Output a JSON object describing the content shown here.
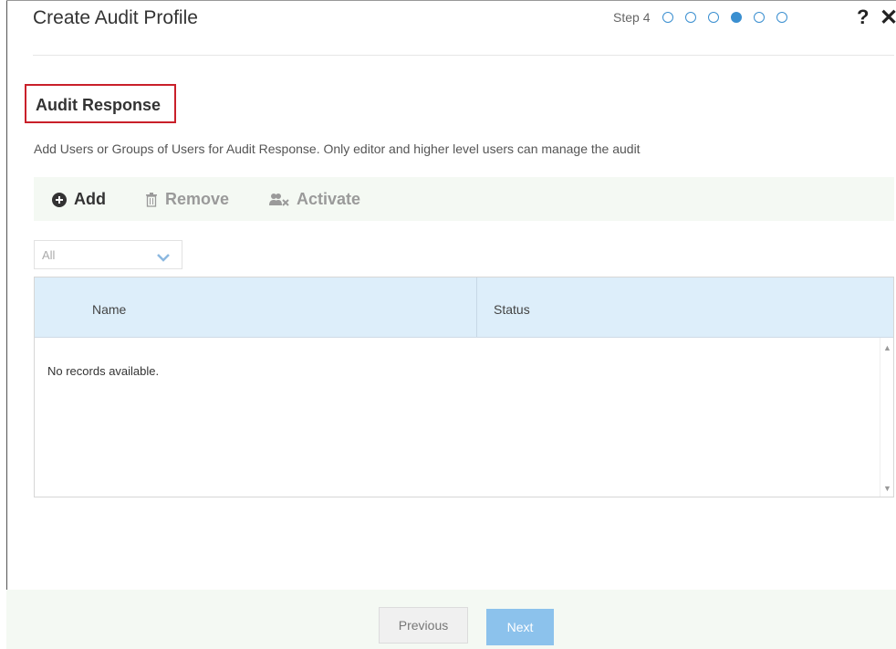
{
  "header": {
    "title": "Create Audit Profile",
    "step_label": "Step 4",
    "steps": [
      false,
      false,
      false,
      true,
      false,
      false
    ],
    "help_glyph": "?",
    "close_glyph": "✕"
  },
  "section": {
    "title": "Audit Response",
    "description": "Add Users or Groups of Users for Audit Response. Only editor and higher level users can manage the audit"
  },
  "toolbar": {
    "add_label": "Add",
    "remove_label": "Remove",
    "activate_label": "Activate",
    "icons": {
      "add": "plus-circle-icon",
      "remove": "trash-icon",
      "activate": "users-activate-icon"
    }
  },
  "filter": {
    "selected": "All"
  },
  "grid": {
    "columns": [
      "Name",
      "Status"
    ],
    "empty_message": "No records available."
  },
  "footer": {
    "previous_label": "Previous",
    "next_label": "Next"
  },
  "colors": {
    "accent": "#3a8fd0",
    "highlight_border": "#c9202a",
    "toolbar_bg": "#f4f9f3",
    "grid_header_bg": "#ddeefa",
    "next_button_bg": "#8cc2ec"
  }
}
